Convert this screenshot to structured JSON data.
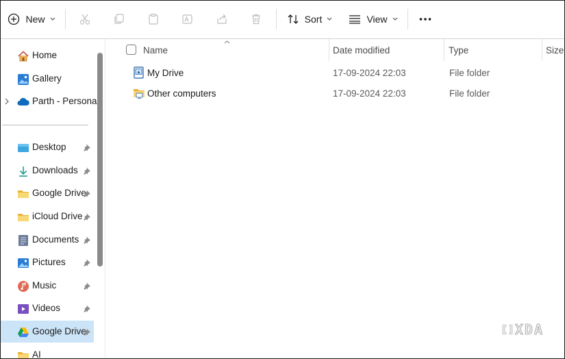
{
  "toolbar": {
    "new_label": "New",
    "sort_label": "Sort",
    "view_label": "View"
  },
  "sidebar": {
    "top_items": [
      {
        "label": "Home",
        "icon": "home-icon"
      },
      {
        "label": "Gallery",
        "icon": "gallery-icon"
      },
      {
        "label": "Parth - Personal",
        "icon": "onedrive-icon"
      }
    ],
    "quick_access": [
      {
        "label": "Desktop",
        "icon": "desktop-icon"
      },
      {
        "label": "Downloads",
        "icon": "downloads-icon"
      },
      {
        "label": "Google Drive",
        "icon": "folder-icon"
      },
      {
        "label": "iCloud Drive",
        "icon": "folder-icon"
      },
      {
        "label": "Documents",
        "icon": "documents-icon"
      },
      {
        "label": "Pictures",
        "icon": "pictures-icon"
      },
      {
        "label": "Music",
        "icon": "music-icon"
      },
      {
        "label": "Videos",
        "icon": "videos-icon"
      },
      {
        "label": "Google Drive",
        "icon": "google-drive-icon"
      },
      {
        "label": "AI",
        "icon": "folder-icon"
      }
    ],
    "selected_label": "Google Drive"
  },
  "columns": {
    "name": "Name",
    "date": "Date modified",
    "type": "Type",
    "size": "Size"
  },
  "files": [
    {
      "name": "My Drive",
      "date": "17-09-2024 22:03",
      "type": "File folder"
    },
    {
      "name": "Other computers",
      "date": "17-09-2024 22:03",
      "type": "File folder"
    }
  ],
  "watermark": "XDA"
}
